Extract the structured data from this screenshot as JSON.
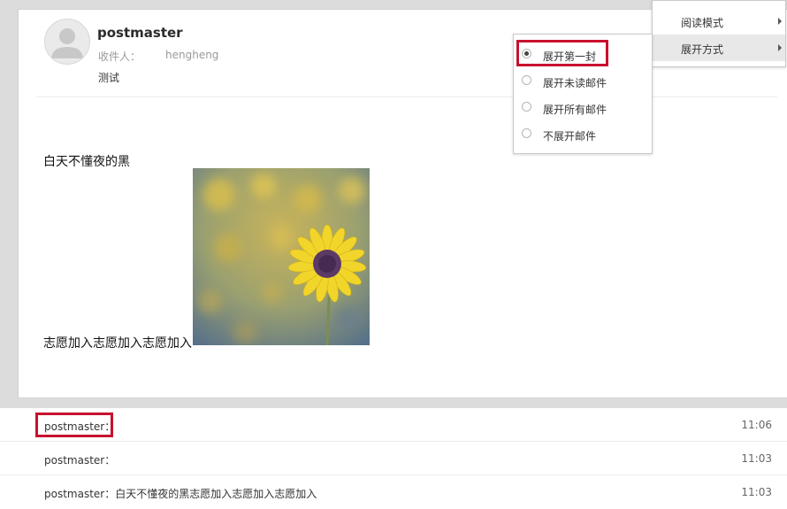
{
  "email": {
    "sender": "postmaster",
    "recipient_label": "收件人：",
    "recipient": "hengheng",
    "subject": "测试",
    "body_line1": "白天不懂夜的黑",
    "body_line2": "志愿加入志愿加入志愿加入",
    "image_icon": "sunflower-image"
  },
  "thread": [
    {
      "sender": "postmaster：",
      "time": "11:06"
    },
    {
      "sender": "postmaster：",
      "time": "11:03"
    },
    {
      "sender": "postmaster：白天不懂夜的黑志愿加入志愿加入志愿加入",
      "time": "11:03"
    }
  ],
  "menu": {
    "items": [
      {
        "label": "阅读模式"
      },
      {
        "label": "展开方式"
      }
    ],
    "expand_options": [
      {
        "label": "展开第一封",
        "checked": true
      },
      {
        "label": "展开未读邮件",
        "checked": false
      },
      {
        "label": "展开所有邮件",
        "checked": false
      },
      {
        "label": "不展开邮件",
        "checked": false
      }
    ]
  },
  "colors": {
    "highlight": "#c8102e",
    "background": "#dcdcdc",
    "hover": "#e8e8e8"
  }
}
